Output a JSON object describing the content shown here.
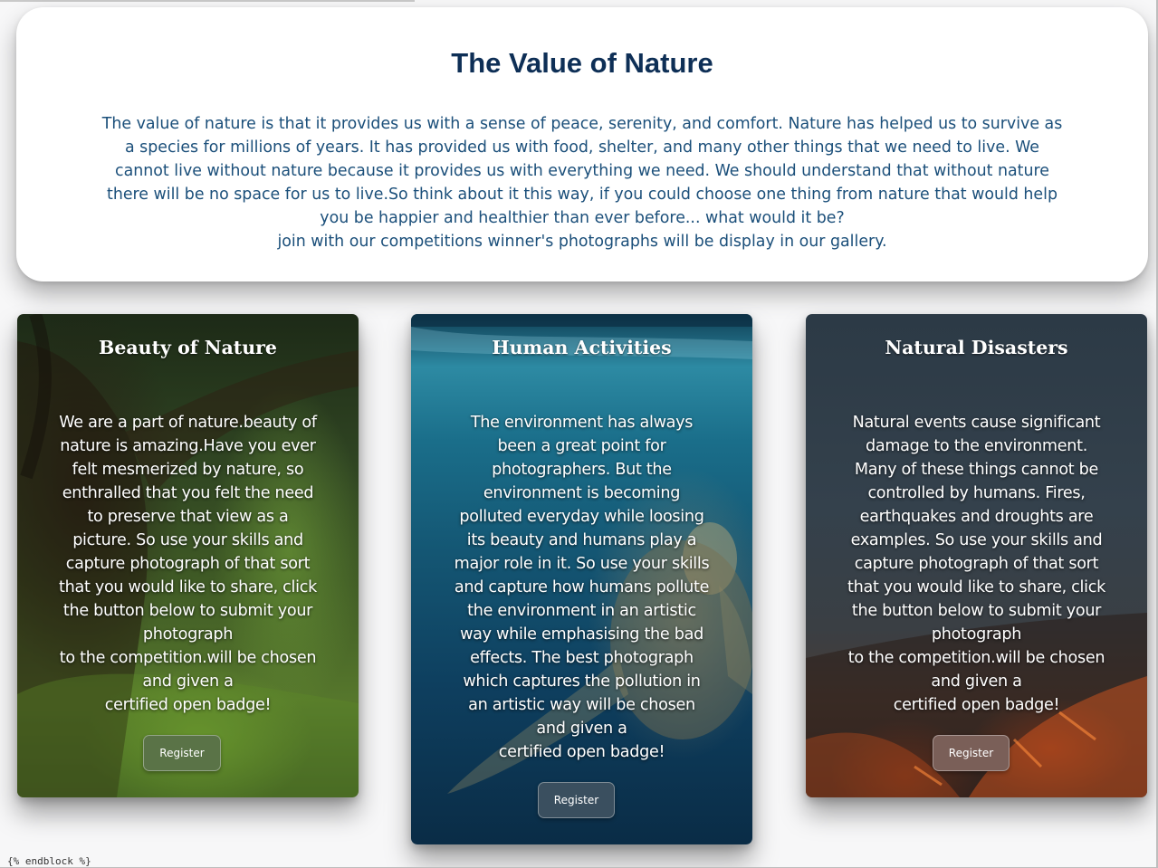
{
  "hero": {
    "title": "The Value of Nature",
    "lines": [
      "The value of nature is that it provides us with a sense of peace, serenity, and comfort. Nature has helped us to survive as",
      "a species for millions of years. It has provided us with food, shelter, and many other things that we need to live. We",
      "cannot live without nature because it provides us with everything we need. We should understand that without nature",
      "there will be no space for us to live.So think about it this way, if you could choose one thing from nature that would help",
      "you be happier and healthier than ever before... what would it be?",
      "join with our competitions winner's photographs will be display in our gallery."
    ]
  },
  "cards": [
    {
      "title": "Beauty of Nature",
      "lines": [
        "We are a part of nature.beauty of",
        "nature is amazing.Have you ever",
        "felt mesmerized by nature, so",
        "enthralled that you felt the need",
        "to preserve that view as a",
        "picture. So use your skills and",
        "capture photograph of that sort",
        "that you would like to share, click",
        "the button below to submit your",
        "photograph",
        "to the competition.will be chosen",
        "and given a",
        "certified open badge!"
      ],
      "button": "Register"
    },
    {
      "title": "Human Activities",
      "lines": [
        "The environment has always",
        "been a great point for",
        "photographers. But the",
        "environment is becoming",
        "polluted everyday while loosing",
        "its beauty and humans play a",
        "major role in it. So use your skills",
        "and capture how humans pollute",
        "the environment in an artistic",
        "way while emphasising the bad",
        "effects. The best photograph",
        "which captures the pollution in",
        "an artistic way will be chosen",
        "and given a",
        "certified open badge!"
      ],
      "button": "Register"
    },
    {
      "title": "Natural Disasters",
      "lines": [
        "Natural events cause significant",
        "damage to the environment.",
        "Many of these things cannot be",
        "controlled by humans. Fires,",
        "earthquakes and droughts are",
        "examples. So use your skills and",
        "capture photograph of that sort",
        "that you would like to share, click",
        "the button below to submit your",
        "photograph",
        "to the competition.will be chosen",
        "and given a",
        "certified open badge!"
      ],
      "button": "Register"
    }
  ],
  "footer": {
    "template_tag": "{% endblock %}"
  }
}
